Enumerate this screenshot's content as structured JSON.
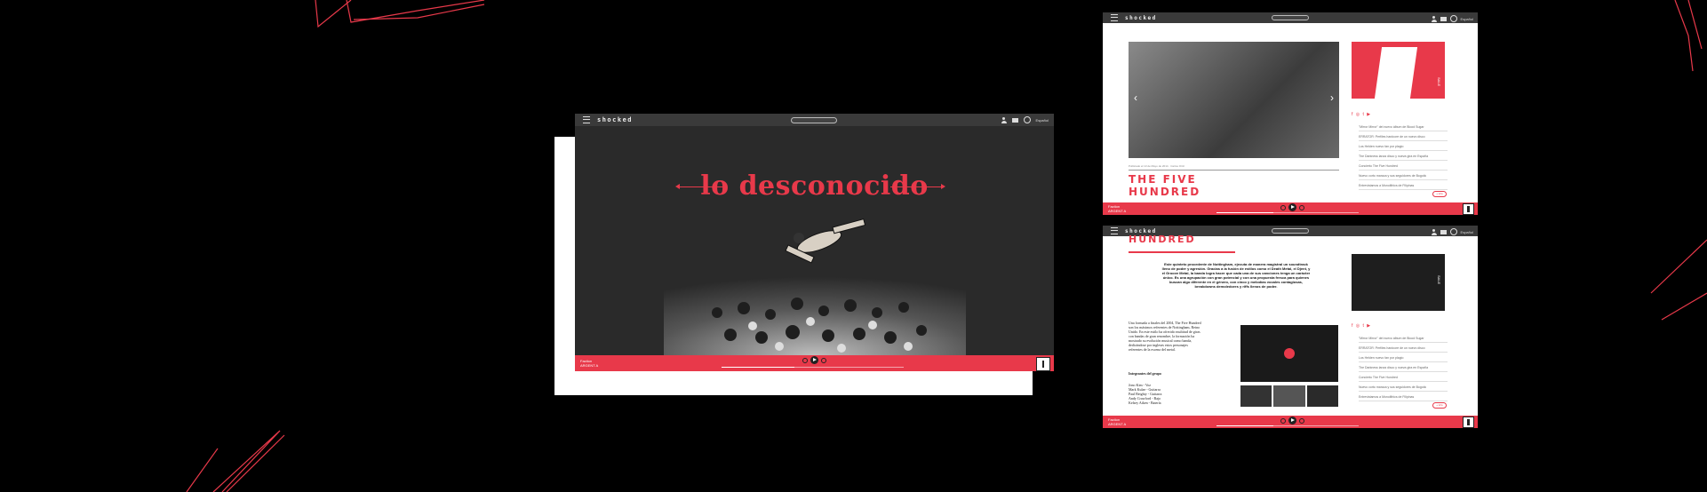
{
  "brand": {
    "logo": "shocked",
    "accent": "#e8394a",
    "dark": "#2a2a2a"
  },
  "main_window": {
    "headline": "lo desconocido",
    "language": "Español",
    "player": {
      "track": "Faction",
      "artist": "ARGENT A",
      "progress": 0.4
    }
  },
  "band_window": {
    "title_line1": "THE FIVE",
    "title_line2": "HUNDRED",
    "photo_caption": "Publicado el 13 de Mayo de 2014 · Carlos Ortiz",
    "side_label": "SALE",
    "news": [
      "\"Mirror Mirror\" del nuevo álbum de Blood Sugar",
      "ERRATOR: Perfiles hardcore de un nuevo disco",
      "Los Helden nuevo fan por plagio",
      "The Darkness lanza disco y nueva gira en España",
      "Concierto The Five Hundred",
      "Nuevo corto maraca y sus seguidores de Bogotá",
      "Entrevistamos a Monolithics de Filipinas"
    ],
    "more": "+ info",
    "player": {
      "track": "Faction",
      "artist": "ARGENT A",
      "progress": 0.4
    }
  },
  "band_detail_window": {
    "title": "HUNDRED",
    "intro": "Este quinteto procedente de Nottingham, ejecuta de manera magistral un soundtrack lleno de poder y agresión. Gracias a la fusión de estilos como el Death Metal, el Djent, y el Groove Metal, la banda logra hacer que cada una de sus canciones tenga un carácter único. Es una agrupación con gran potencial y con una propuesta fresca para quienes buscan algo diferente en el género, con cinco y melodías vocales contagiosas, breakdowns demoledores y riffs llenos de poder.",
    "bio": "Una formada a finales del 2004, The Five Hundred son los máximos referentes de Nottingham, Reino Unido. En este estilo ha ofrecido multitud de giras con bandas de gran renombre, la formación ha mostrado su evolución musical como banda, dedicándose por ingleses estos personajes referentes de la escena del metal.",
    "members_heading": "Integrantes del grupo",
    "members": [
      "Jono Kim - Voz",
      "Mark Kulae - Guitarra",
      "Paul Beighty - Guitarra",
      "Andy Crawford - Bajo",
      "Kelsey Aiken - Batería"
    ],
    "side_label": "SALE",
    "news": [
      "\"Mirror Mirror\" del nuevo álbum de Blood Sugar",
      "ERRATOR: Perfiles hardcore de un nuevo disco",
      "Los Helden nuevo fan por plagio",
      "The Darkness lanza disco y nueva gira en España",
      "Concierto The Five Hundred",
      "Nuevo corto maraca y sus seguidores de Bogotá",
      "Entrevistamos a Monolithics de Filipinas"
    ],
    "more": "+ info",
    "player": {
      "track": "Faction",
      "artist": "ARGENT A",
      "progress": 0.4
    }
  }
}
